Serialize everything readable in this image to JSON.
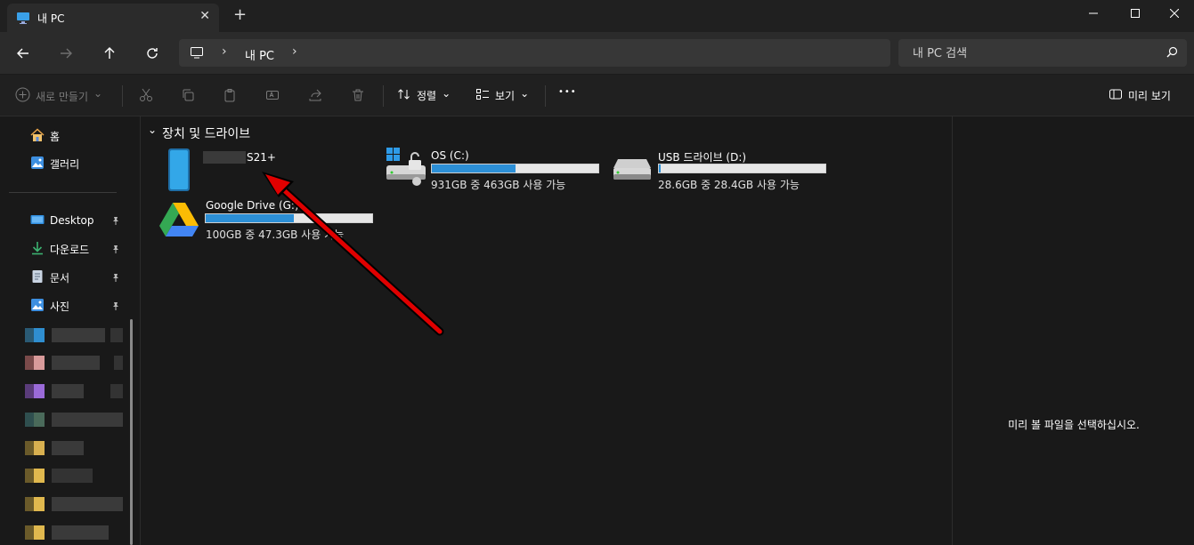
{
  "window": {
    "tab_title": "내 PC",
    "tab_close_glyph": "✕",
    "new_tab_glyph": "+",
    "minimize_glyph": "—",
    "close_glyph": "✕"
  },
  "nav": {
    "address_separator": "›",
    "address_text": "내 PC",
    "search_placeholder": "내 PC 검색"
  },
  "command_bar": {
    "new_label": "새로 만들기",
    "sort_label": "정렬",
    "view_label": "보기",
    "more_glyph": "•••",
    "preview_label": "미리 보기",
    "dropdown_glyph": "⌄"
  },
  "sidebar": {
    "items": [
      {
        "label": "홈"
      },
      {
        "label": "갤러리"
      },
      {
        "label": "Desktop"
      },
      {
        "label": "다운로드"
      },
      {
        "label": "문서"
      },
      {
        "label": "사진"
      }
    ],
    "pin_glyph": "📌"
  },
  "main": {
    "group_header": "장치 및 드라이브",
    "group_chevron": "⌄",
    "phone_name_suffix": "S21+",
    "drives": [
      {
        "name": "OS (C:)",
        "info": "931GB 중 463GB 사용 가능",
        "used_fraction": 0.503
      },
      {
        "name": "USB 드라이브 (D:)",
        "info": "28.6GB 중 28.4GB 사용 가능",
        "used_fraction": 0.007
      },
      {
        "name": "Google Drive (G:)",
        "info": "100GB 중 47.3GB 사용 가능",
        "used_fraction": 0.527
      }
    ]
  },
  "preview": {
    "message": "미리 볼 파일을 선택하십시오."
  },
  "colors": {
    "accent": "#2c8fd6",
    "annotation_arrow": "#e00000"
  }
}
